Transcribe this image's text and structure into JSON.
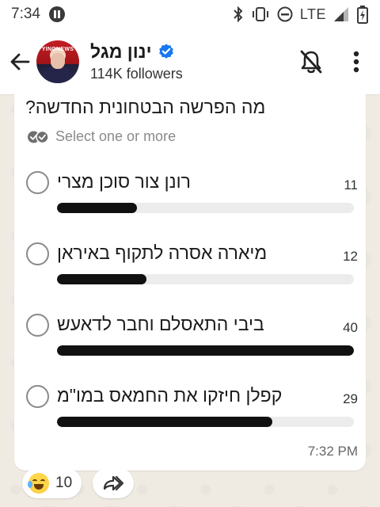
{
  "status_bar": {
    "time": "7:34",
    "network": "LTE"
  },
  "header": {
    "channel_name": "ינון מגל",
    "followers": "114K followers",
    "avatar_brand": "YINONEWS"
  },
  "poll": {
    "question": "מה הפרשה הבטחונית החדשה?",
    "select_hint": "Select one or more",
    "options": [
      {
        "label": "רונן צור סוכן מצרי",
        "votes": "11",
        "fraction": 0.27
      },
      {
        "label": "מיארה אסרה לתקוף באיראן",
        "votes": "12",
        "fraction": 0.3
      },
      {
        "label": "ביבי התאסלם וחבר לדאעש",
        "votes": "40",
        "fraction": 1.0
      },
      {
        "label": "קפלן חיזקו את החמאס במו\"מ",
        "votes": "29",
        "fraction": 0.725
      }
    ],
    "time": "7:32 PM"
  },
  "reactions": {
    "count": "10"
  },
  "icons": {
    "back": "arrow-left-icon",
    "verified": "verified-badge-icon",
    "mute": "bell-off-icon",
    "menu": "more-vertical-icon",
    "forward": "forward-icon",
    "select_multiple": "double-check-icon"
  },
  "colors": {
    "bar_fill": "#111111",
    "verified": "#1877f2"
  }
}
